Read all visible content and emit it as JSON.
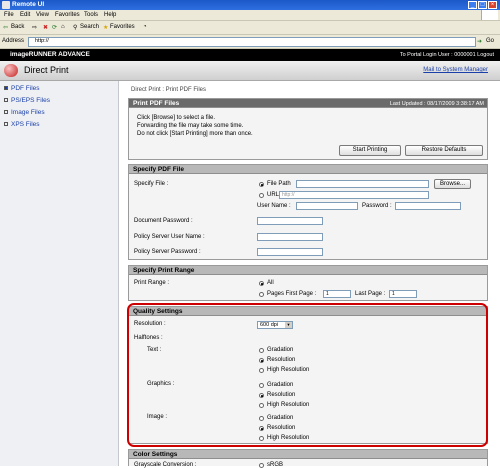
{
  "window": {
    "title": "Remote UI"
  },
  "menubar": {
    "items": [
      "File",
      "Edit",
      "View",
      "Favorites",
      "Tools",
      "Help"
    ]
  },
  "toolbar": {
    "back": "Back",
    "search": "Search",
    "favorites": "Favorites"
  },
  "address": {
    "label": "Address",
    "value": "http://",
    "go": "Go"
  },
  "appbar": {
    "brand": "imageRUNNER ADVANCE",
    "links": "To Portal   Login User : 0000001   Logout"
  },
  "header": {
    "title": "Direct Print",
    "mail": "Mail to System Manager"
  },
  "sidebar": {
    "items": [
      "PDF Files",
      "PS/EPS Files",
      "Image Files",
      "XPS Files"
    ]
  },
  "breadcrumb": "Direct Print : Print PDF Files",
  "print_pdf": {
    "heading": "Print PDF Files",
    "updated": "Last Updated : 08/17/2009 3:38:17 AM",
    "instructions": [
      "Click [Browse] to select a file.",
      "Forwarding the file may take some time.",
      "Do not click [Start Printing] more than once."
    ],
    "start_button": "Start Printing",
    "restore_button": "Restore Defaults"
  },
  "specify_pdf": {
    "heading": "Specify PDF File",
    "specify_file_label": "Specify File :",
    "file_path_option": "File Path",
    "browse_button": "Browse...",
    "url_option": "URL",
    "url_placeholder": "http://",
    "user_name_label": "User Name :",
    "password_label": "Password :",
    "document_password_label": "Document Password :",
    "policy_user_label": "Policy Server User Name :",
    "policy_password_label": "Policy Server Password :"
  },
  "print_range": {
    "heading": "Specify Print Range",
    "label": "Print Range :",
    "all_option": "All",
    "pages_option": "Pages First Page :",
    "first_value": "1",
    "last_label": "Last Page :",
    "last_value": "1"
  },
  "quality": {
    "heading": "Quality Settings",
    "resolution_label": "Resolution :",
    "resolution_value": "600 dpi",
    "halftones_label": "Halftones :",
    "text_label": "Text :",
    "graphics_label": "Graphics :",
    "image_label": "Image :",
    "options": [
      "Gradation",
      "Resolution",
      "High Resolution"
    ],
    "selected": "Resolution"
  },
  "color": {
    "heading": "Color Settings",
    "grayscale_label": "Grayscale Conversion :",
    "grayscale_value": "sRGB"
  }
}
